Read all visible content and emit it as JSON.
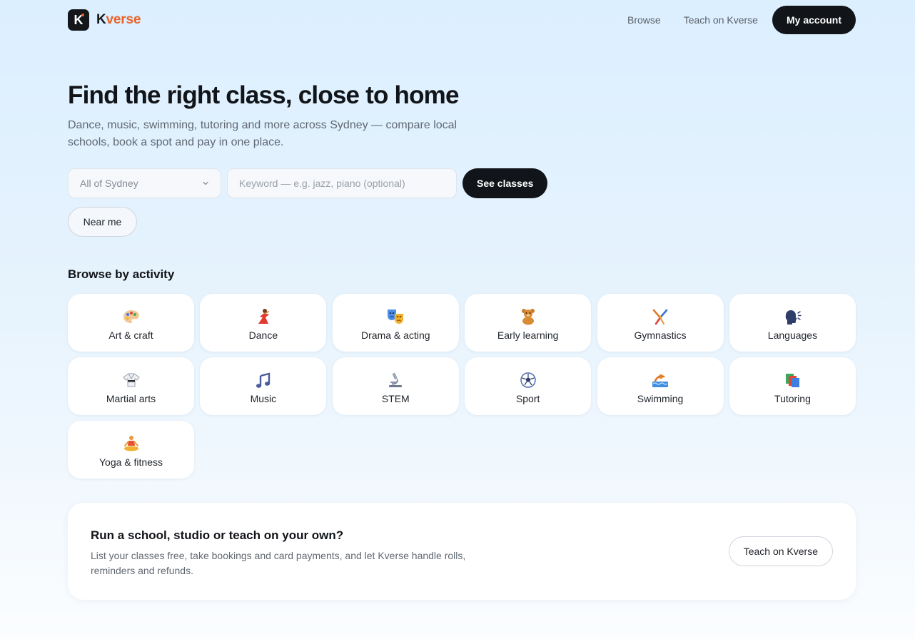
{
  "nav": {
    "brand_k": "K",
    "brand_rest": "verse",
    "browse": "Browse",
    "teach": "Teach on Kverse",
    "account": "My account"
  },
  "hero": {
    "title": "Find the right class, close to home",
    "subtitle": "Dance, music, swimming, tutoring and more across Sydney — compare local schools, book a spot and pay in one place."
  },
  "search": {
    "location": "All of Sydney",
    "keyword_placeholder": "Keyword — e.g. jazz, piano (optional)",
    "submit": "See classes",
    "near_me": "Near me"
  },
  "browse": {
    "title": "Browse by activity",
    "activities": [
      {
        "label": "Art & craft",
        "icon": "palette-icon"
      },
      {
        "label": "Dance",
        "icon": "dancer-icon"
      },
      {
        "label": "Drama & acting",
        "icon": "theater-masks-icon"
      },
      {
        "label": "Early learning",
        "icon": "teddy-bear-icon"
      },
      {
        "label": "Gymnastics",
        "icon": "cartwheel-icon"
      },
      {
        "label": "Languages",
        "icon": "speaking-head-icon"
      },
      {
        "label": "Martial arts",
        "icon": "martial-arts-uniform-icon"
      },
      {
        "label": "Music",
        "icon": "musical-notes-icon"
      },
      {
        "label": "STEM",
        "icon": "microscope-icon"
      },
      {
        "label": "Sport",
        "icon": "soccer-ball-icon"
      },
      {
        "label": "Swimming",
        "icon": "swimmer-icon"
      },
      {
        "label": "Tutoring",
        "icon": "books-icon"
      },
      {
        "label": "Yoga & fitness",
        "icon": "lotus-position-icon"
      }
    ]
  },
  "cta": {
    "title": "Run a school, studio or teach on your own?",
    "text": "List your classes free, take bookings and card payments, and let Kverse handle rolls, reminders and refunds.",
    "button": "Teach on Kverse"
  },
  "colors": {
    "accent": "#e8632b",
    "dark": "#111418",
    "muted_text": "#616972",
    "background_top": "#dcefff"
  }
}
